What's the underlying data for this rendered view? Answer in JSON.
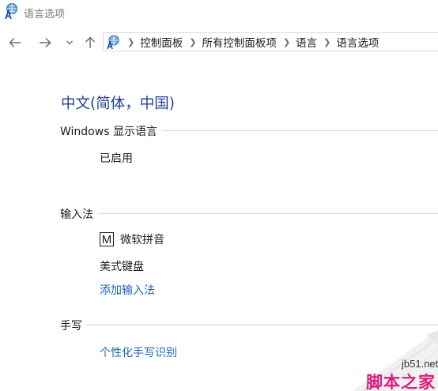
{
  "window": {
    "title": "语言选项",
    "app_icon": "language-options-icon"
  },
  "navbar": {
    "back_icon": "back-arrow-icon",
    "forward_icon": "forward-arrow-icon",
    "recent_icon": "chevron-down-icon",
    "up_icon": "up-arrow-icon",
    "breadcrumbs": [
      "控制面板",
      "所有控制面板项",
      "语言",
      "语言选项"
    ]
  },
  "content": {
    "language_name": "中文(简体，中国)",
    "display_language": {
      "label": "Windows 显示语言",
      "status": "已启用"
    },
    "input_methods": {
      "label": "输入法",
      "items": [
        {
          "icon_glyph": "M",
          "name": "微软拼音"
        },
        {
          "name": "美式键盘"
        }
      ],
      "add_link": "添加输入法"
    },
    "handwriting": {
      "label": "手写",
      "link": "个性化手写识别"
    }
  },
  "watermark": {
    "site": "jb51.net",
    "name": "脚本之家"
  },
  "colors": {
    "heading": "#1e3f94",
    "link": "#1d64b8",
    "watermark": "#e0197d"
  }
}
